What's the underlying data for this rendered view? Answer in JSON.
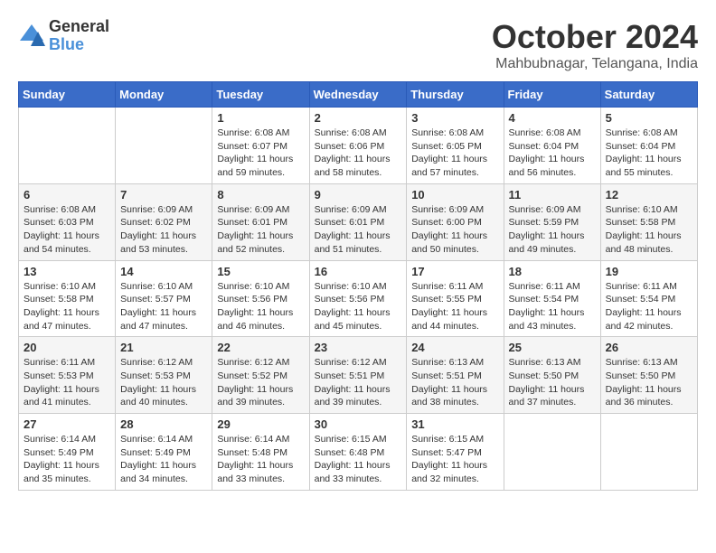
{
  "logo": {
    "general": "General",
    "blue": "Blue"
  },
  "header": {
    "month": "October 2024",
    "location": "Mahbubnagar, Telangana, India"
  },
  "weekdays": [
    "Sunday",
    "Monday",
    "Tuesday",
    "Wednesday",
    "Thursday",
    "Friday",
    "Saturday"
  ],
  "weeks": [
    [
      {
        "day": "",
        "sunrise": "",
        "sunset": "",
        "daylight": ""
      },
      {
        "day": "",
        "sunrise": "",
        "sunset": "",
        "daylight": ""
      },
      {
        "day": "1",
        "sunrise": "Sunrise: 6:08 AM",
        "sunset": "Sunset: 6:07 PM",
        "daylight": "Daylight: 11 hours and 59 minutes."
      },
      {
        "day": "2",
        "sunrise": "Sunrise: 6:08 AM",
        "sunset": "Sunset: 6:06 PM",
        "daylight": "Daylight: 11 hours and 58 minutes."
      },
      {
        "day": "3",
        "sunrise": "Sunrise: 6:08 AM",
        "sunset": "Sunset: 6:05 PM",
        "daylight": "Daylight: 11 hours and 57 minutes."
      },
      {
        "day": "4",
        "sunrise": "Sunrise: 6:08 AM",
        "sunset": "Sunset: 6:04 PM",
        "daylight": "Daylight: 11 hours and 56 minutes."
      },
      {
        "day": "5",
        "sunrise": "Sunrise: 6:08 AM",
        "sunset": "Sunset: 6:04 PM",
        "daylight": "Daylight: 11 hours and 55 minutes."
      }
    ],
    [
      {
        "day": "6",
        "sunrise": "Sunrise: 6:08 AM",
        "sunset": "Sunset: 6:03 PM",
        "daylight": "Daylight: 11 hours and 54 minutes."
      },
      {
        "day": "7",
        "sunrise": "Sunrise: 6:09 AM",
        "sunset": "Sunset: 6:02 PM",
        "daylight": "Daylight: 11 hours and 53 minutes."
      },
      {
        "day": "8",
        "sunrise": "Sunrise: 6:09 AM",
        "sunset": "Sunset: 6:01 PM",
        "daylight": "Daylight: 11 hours and 52 minutes."
      },
      {
        "day": "9",
        "sunrise": "Sunrise: 6:09 AM",
        "sunset": "Sunset: 6:01 PM",
        "daylight": "Daylight: 11 hours and 51 minutes."
      },
      {
        "day": "10",
        "sunrise": "Sunrise: 6:09 AM",
        "sunset": "Sunset: 6:00 PM",
        "daylight": "Daylight: 11 hours and 50 minutes."
      },
      {
        "day": "11",
        "sunrise": "Sunrise: 6:09 AM",
        "sunset": "Sunset: 5:59 PM",
        "daylight": "Daylight: 11 hours and 49 minutes."
      },
      {
        "day": "12",
        "sunrise": "Sunrise: 6:10 AM",
        "sunset": "Sunset: 5:58 PM",
        "daylight": "Daylight: 11 hours and 48 minutes."
      }
    ],
    [
      {
        "day": "13",
        "sunrise": "Sunrise: 6:10 AM",
        "sunset": "Sunset: 5:58 PM",
        "daylight": "Daylight: 11 hours and 47 minutes."
      },
      {
        "day": "14",
        "sunrise": "Sunrise: 6:10 AM",
        "sunset": "Sunset: 5:57 PM",
        "daylight": "Daylight: 11 hours and 47 minutes."
      },
      {
        "day": "15",
        "sunrise": "Sunrise: 6:10 AM",
        "sunset": "Sunset: 5:56 PM",
        "daylight": "Daylight: 11 hours and 46 minutes."
      },
      {
        "day": "16",
        "sunrise": "Sunrise: 6:10 AM",
        "sunset": "Sunset: 5:56 PM",
        "daylight": "Daylight: 11 hours and 45 minutes."
      },
      {
        "day": "17",
        "sunrise": "Sunrise: 6:11 AM",
        "sunset": "Sunset: 5:55 PM",
        "daylight": "Daylight: 11 hours and 44 minutes."
      },
      {
        "day": "18",
        "sunrise": "Sunrise: 6:11 AM",
        "sunset": "Sunset: 5:54 PM",
        "daylight": "Daylight: 11 hours and 43 minutes."
      },
      {
        "day": "19",
        "sunrise": "Sunrise: 6:11 AM",
        "sunset": "Sunset: 5:54 PM",
        "daylight": "Daylight: 11 hours and 42 minutes."
      }
    ],
    [
      {
        "day": "20",
        "sunrise": "Sunrise: 6:11 AM",
        "sunset": "Sunset: 5:53 PM",
        "daylight": "Daylight: 11 hours and 41 minutes."
      },
      {
        "day": "21",
        "sunrise": "Sunrise: 6:12 AM",
        "sunset": "Sunset: 5:53 PM",
        "daylight": "Daylight: 11 hours and 40 minutes."
      },
      {
        "day": "22",
        "sunrise": "Sunrise: 6:12 AM",
        "sunset": "Sunset: 5:52 PM",
        "daylight": "Daylight: 11 hours and 39 minutes."
      },
      {
        "day": "23",
        "sunrise": "Sunrise: 6:12 AM",
        "sunset": "Sunset: 5:51 PM",
        "daylight": "Daylight: 11 hours and 39 minutes."
      },
      {
        "day": "24",
        "sunrise": "Sunrise: 6:13 AM",
        "sunset": "Sunset: 5:51 PM",
        "daylight": "Daylight: 11 hours and 38 minutes."
      },
      {
        "day": "25",
        "sunrise": "Sunrise: 6:13 AM",
        "sunset": "Sunset: 5:50 PM",
        "daylight": "Daylight: 11 hours and 37 minutes."
      },
      {
        "day": "26",
        "sunrise": "Sunrise: 6:13 AM",
        "sunset": "Sunset: 5:50 PM",
        "daylight": "Daylight: 11 hours and 36 minutes."
      }
    ],
    [
      {
        "day": "27",
        "sunrise": "Sunrise: 6:14 AM",
        "sunset": "Sunset: 5:49 PM",
        "daylight": "Daylight: 11 hours and 35 minutes."
      },
      {
        "day": "28",
        "sunrise": "Sunrise: 6:14 AM",
        "sunset": "Sunset: 5:49 PM",
        "daylight": "Daylight: 11 hours and 34 minutes."
      },
      {
        "day": "29",
        "sunrise": "Sunrise: 6:14 AM",
        "sunset": "Sunset: 5:48 PM",
        "daylight": "Daylight: 11 hours and 33 minutes."
      },
      {
        "day": "30",
        "sunrise": "Sunrise: 6:15 AM",
        "sunset": "Sunset: 6:48 PM",
        "daylight": "Daylight: 11 hours and 33 minutes."
      },
      {
        "day": "31",
        "sunrise": "Sunrise: 6:15 AM",
        "sunset": "Sunset: 5:47 PM",
        "daylight": "Daylight: 11 hours and 32 minutes."
      },
      {
        "day": "",
        "sunrise": "",
        "sunset": "",
        "daylight": ""
      },
      {
        "day": "",
        "sunrise": "",
        "sunset": "",
        "daylight": ""
      }
    ]
  ]
}
